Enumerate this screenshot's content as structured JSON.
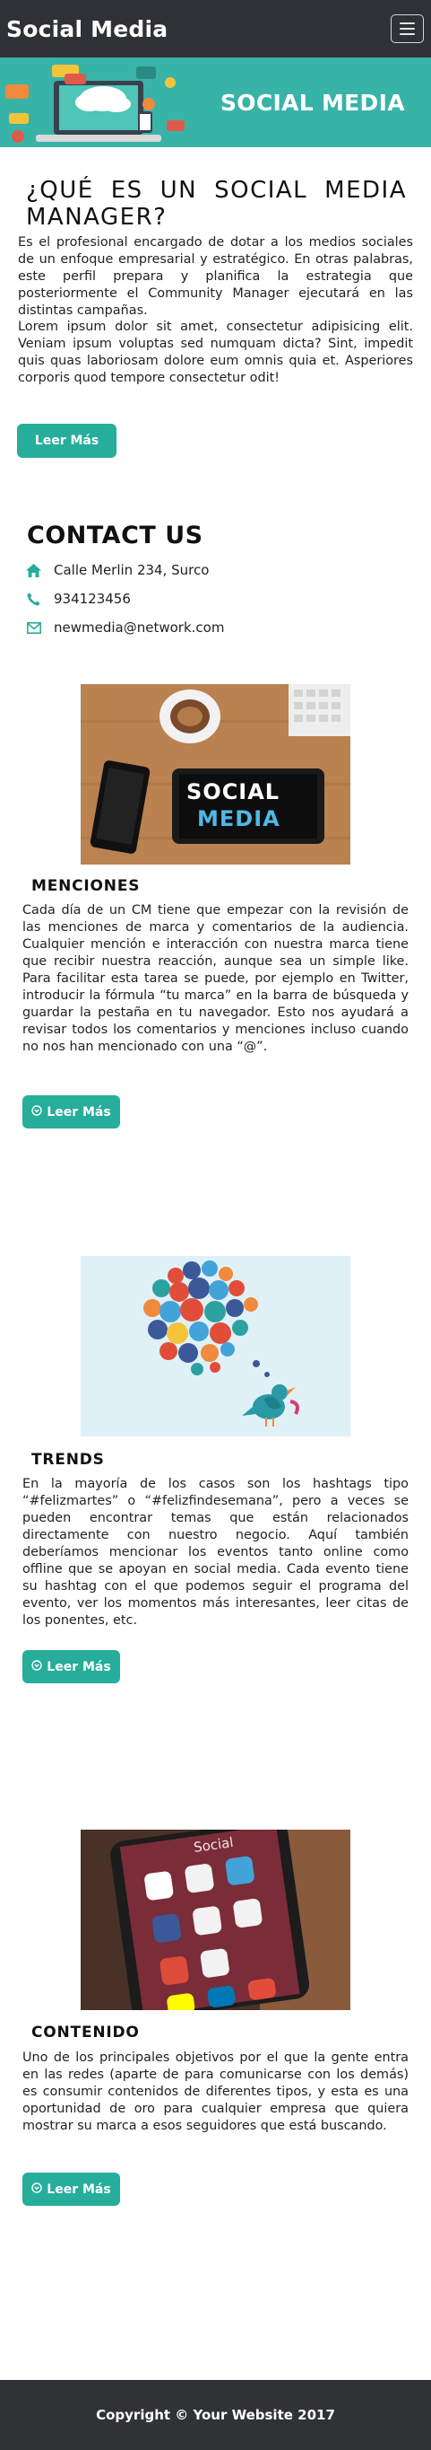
{
  "navbar": {
    "brand": "Social Media",
    "menu_icon": "hamburger-menu-icon"
  },
  "banner": {
    "title": "SOCIAL MEDIA"
  },
  "intro": {
    "title": "¿QUÉ ES UN SOCIAL MEDIA MANAGER?",
    "paragraph1": "Es el profesional encargado de dotar a los medios sociales de un enfoque empresarial y estratégico. En otras palabras, este perfil prepara y planifica la estrategia que posteriormente el Community Manager ejecutará en las distintas campañas.",
    "paragraph2": "Lorem ipsum dolor sit amet, consectetur adipisicing elit. Veniam ipsum voluptas sed numquam dicta? Sint, impedit quis quas laboriosam dolore eum omnis quia et. Asperiores corporis quod tempore consectetur odit!",
    "button": "Leer Más"
  },
  "contact": {
    "title": "CONTACT US",
    "address": "Calle Merlin 234, Surco",
    "phone": "934123456",
    "email": "newmedia@network.com"
  },
  "cards": [
    {
      "image_label": "SOCIAL",
      "image_label2": "MEDIA",
      "title": "MENCIONES",
      "text": "Cada día de un CM tiene que empezar con la revisión de las menciones de marca y comentarios de la audiencia. Cualquier mención e interacción con nuestra marca tiene que recibir nuestra reacción, aunque sea un simple like. Para facilitar esta tarea se puede, por ejemplo en Twitter, introducir la fórmula “tu marca” en la barra de búsqueda y guardar la pestaña en tu navegador. Esto nos ayudará a revisar todos los comentarios y menciones incluso cuando no nos han mencionado con una “@”.",
      "button": "Leer Más"
    },
    {
      "title": "TRENDS",
      "text": "En la mayoría de los casos son los hashtags tipo “#felizmartes” o “#felizfindesemana”, pero a veces se pueden encontrar temas que están relacionados directamente con nuestro negocio. Aquí también deberíamos mencionar los eventos tanto online como offline que se apoyan en social media. Cada evento tiene su hashtag con el que podemos seguir el programa del evento, ver los momentos más interesantes, leer citas de los ponentes, etc.",
      "button": "Leer Más"
    },
    {
      "image_label": "Social",
      "title": "CONTENIDO",
      "text": "Uno de los principales objetivos por el que la gente entra en las redes (aparte de para comunicarse con los demás) es consumir contenidos de diferentes tipos, y esta es una oportunidad de oro para cualquier empresa que quiera mostrar su marca a esos seguidores que está buscando.",
      "button": "Leer Más"
    }
  ],
  "footer": {
    "text": "Copyright © Your Website 2017"
  },
  "colors": {
    "navbar": "#2f3136",
    "banner": "#38b3a8",
    "button": "#27ad9c",
    "icon": "#27ad9c",
    "footer": "#303236"
  }
}
